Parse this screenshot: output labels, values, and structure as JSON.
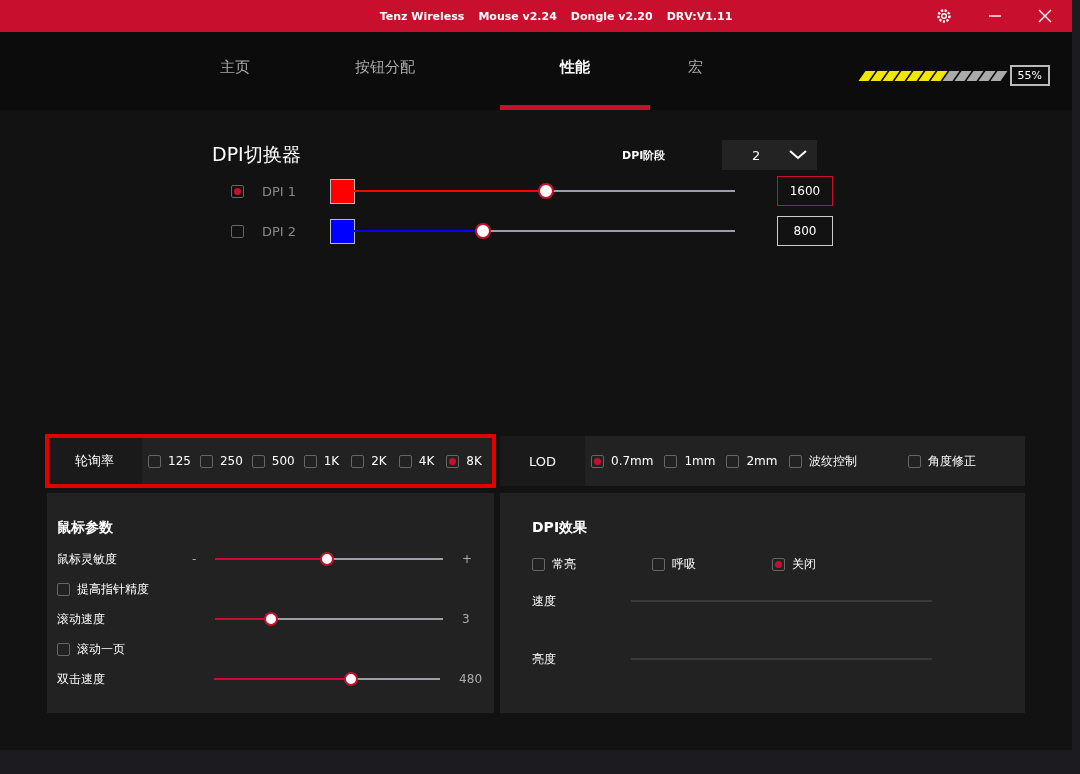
{
  "title_bar": {
    "texts": [
      "Tenz Wireless",
      "Mouse v2.24",
      "Dongle v2.20",
      "DRV:V1.11"
    ]
  },
  "tabs": [
    {
      "label": "主页",
      "selected": false
    },
    {
      "label": "按钮分配",
      "selected": false
    },
    {
      "label": "性能",
      "selected": true
    },
    {
      "label": "宏",
      "selected": false
    }
  ],
  "battery": {
    "level": 0.55,
    "reading": "55%"
  },
  "dpi_switcher": {
    "title": "DPI切换器",
    "stage_label": "DPI阶段",
    "stage_value": "2",
    "rows": [
      {
        "label": "DPI 1",
        "selected": true,
        "color": "#ff0000",
        "level": 0.5,
        "value": "1600"
      },
      {
        "label": "DPI 2",
        "selected": false,
        "color": "#0000ff",
        "level": 0.34,
        "value": "800"
      }
    ]
  },
  "polling_rate": {
    "label": "轮询率",
    "highlighted": true,
    "options": [
      {
        "label": "125",
        "selected": false
      },
      {
        "label": "250",
        "selected": false
      },
      {
        "label": "500",
        "selected": false
      },
      {
        "label": "1K",
        "selected": false
      },
      {
        "label": "2K",
        "selected": false
      },
      {
        "label": "4K",
        "selected": false
      },
      {
        "label": "8K",
        "selected": true
      }
    ]
  },
  "lod": {
    "label": "LOD",
    "options": [
      {
        "label": "0.7mm",
        "checked": true
      },
      {
        "label": "1mm",
        "checked": false
      },
      {
        "label": "2mm",
        "checked": false
      },
      {
        "label": "波纹控制",
        "checked": false
      },
      {
        "label": "角度修正",
        "checked": false
      }
    ]
  },
  "mouse_params": {
    "title": "鼠标参数",
    "rows": [
      {
        "kind": "slider",
        "label": "鼠标灵敏度",
        "min_label": "-",
        "max_label": "+",
        "level": 0.475
      },
      {
        "kind": "checkbox",
        "label": "提高指针精度",
        "checked": false
      },
      {
        "kind": "slider",
        "label": "滚动速度",
        "reading": "3",
        "level": 0.24
      },
      {
        "kind": "checkbox",
        "label": "滚动一页",
        "checked": false
      },
      {
        "kind": "slider",
        "label": "双击速度",
        "reading": "480",
        "level": 0.59
      }
    ]
  },
  "dpi_effect": {
    "title": "DPI效果",
    "modes": [
      {
        "label": "常亮",
        "selected": false
      },
      {
        "label": "呼吸",
        "selected": false
      },
      {
        "label": "关闭",
        "selected": true
      }
    ],
    "sliders": [
      {
        "label": "速度",
        "disabled": true
      },
      {
        "label": "亮度",
        "disabled": true
      }
    ]
  }
}
